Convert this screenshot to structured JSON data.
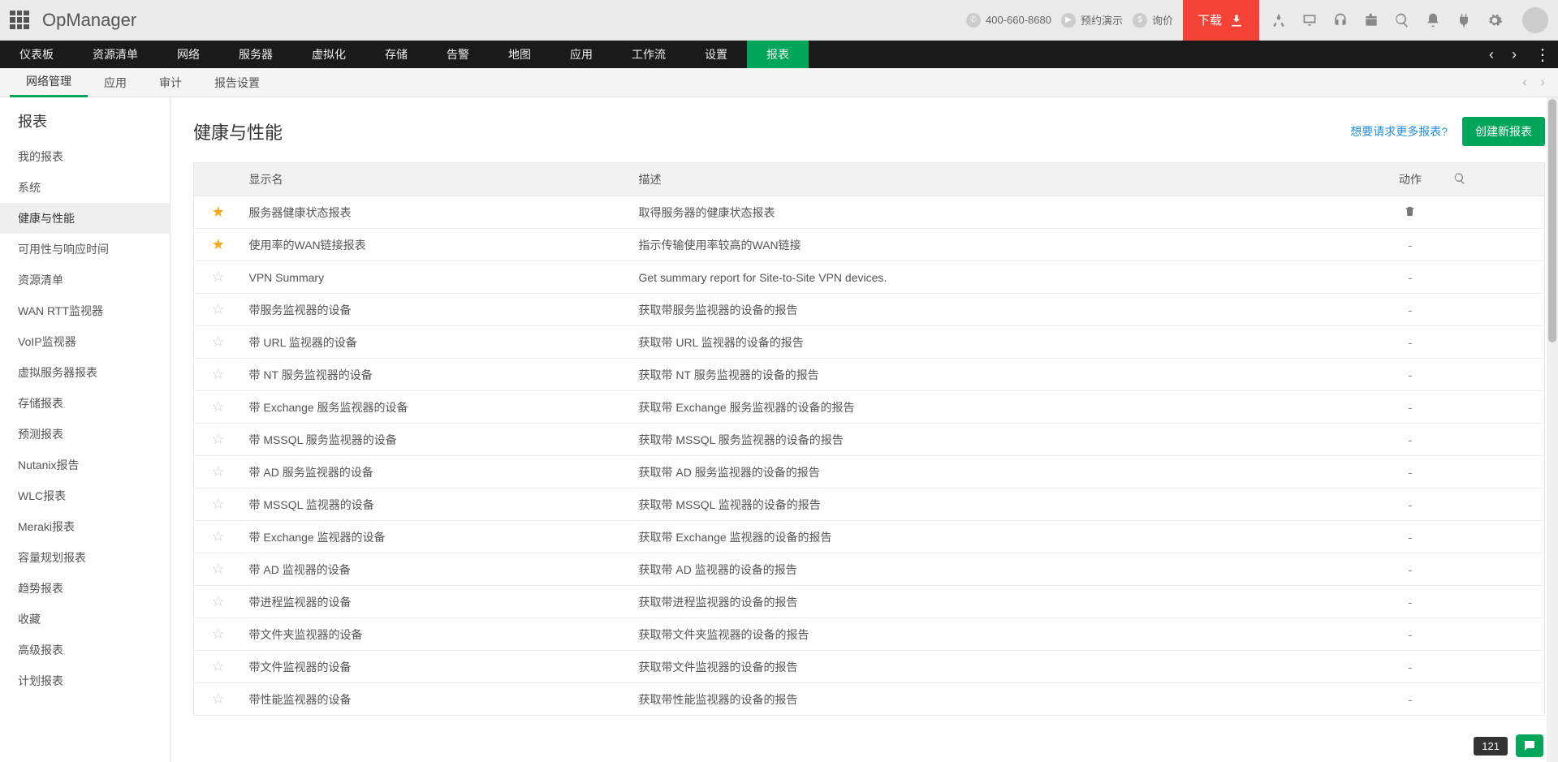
{
  "header": {
    "logo": "OpManager",
    "phone": "400-660-8680",
    "demo": "预约演示",
    "inquiry": "询价",
    "download": "下载"
  },
  "mainNav": [
    "仪表板",
    "资源清单",
    "网络",
    "服务器",
    "虚拟化",
    "存储",
    "告警",
    "地图",
    "应用",
    "工作流",
    "设置",
    "报表"
  ],
  "mainNavActive": "报表",
  "subNav": [
    "网络管理",
    "应用",
    "审计",
    "报告设置"
  ],
  "subNavActive": "网络管理",
  "sidebar": {
    "title": "报表",
    "items": [
      "我的报表",
      "系统",
      "健康与性能",
      "可用性与响应时间",
      "资源清单",
      "WAN RTT监视器",
      "VoIP监视器",
      "虚拟服务器报表",
      "存储报表",
      "预测报表",
      "Nutanix报告",
      "WLC报表",
      "Meraki报表",
      "容量规划报表",
      "趋势报表",
      "收藏",
      "高级报表",
      "计划报表"
    ],
    "active": "健康与性能"
  },
  "content": {
    "title": "健康与性能",
    "requestMore": "想要请求更多报表?",
    "createBtn": "创建新报表",
    "columns": {
      "name": "显示名",
      "desc": "描述",
      "action": "动作"
    },
    "rows": [
      {
        "fav": true,
        "name": "服务器健康状态报表",
        "desc": "取得服务器的健康状态报表",
        "deletable": true
      },
      {
        "fav": true,
        "name": "使用率的WAN链接报表",
        "desc": "指示传输使用率较高的WAN链接",
        "deletable": false
      },
      {
        "fav": false,
        "name": "VPN Summary",
        "desc": "Get summary report for Site-to-Site VPN devices.",
        "deletable": false
      },
      {
        "fav": false,
        "name": "带服务监视器的设备",
        "desc": "获取带服务监视器的设备的报告",
        "deletable": false
      },
      {
        "fav": false,
        "name": "带 URL 监视器的设备",
        "desc": "获取带 URL 监视器的设备的报告",
        "deletable": false
      },
      {
        "fav": false,
        "name": "带 NT 服务监视器的设备",
        "desc": "获取带 NT 服务监视器的设备的报告",
        "deletable": false
      },
      {
        "fav": false,
        "name": "带 Exchange 服务监视器的设备",
        "desc": "获取带 Exchange 服务监视器的设备的报告",
        "deletable": false
      },
      {
        "fav": false,
        "name": "带 MSSQL 服务监视器的设备",
        "desc": "获取带 MSSQL 服务监视器的设备的报告",
        "deletable": false
      },
      {
        "fav": false,
        "name": "带 AD 服务监视器的设备",
        "desc": "获取带 AD 服务监视器的设备的报告",
        "deletable": false
      },
      {
        "fav": false,
        "name": "带 MSSQL 监视器的设备",
        "desc": "获取带 MSSQL 监视器的设备的报告",
        "deletable": false
      },
      {
        "fav": false,
        "name": "带 Exchange 监视器的设备",
        "desc": "获取带 Exchange 监视器的设备的报告",
        "deletable": false
      },
      {
        "fav": false,
        "name": "带 AD 监视器的设备",
        "desc": "获取带 AD 监视器的设备的报告",
        "deletable": false
      },
      {
        "fav": false,
        "name": "带进程监视器的设备",
        "desc": "获取带进程监视器的设备的报告",
        "deletable": false
      },
      {
        "fav": false,
        "name": "带文件夹监视器的设备",
        "desc": "获取带文件夹监视器的设备的报告",
        "deletable": false
      },
      {
        "fav": false,
        "name": "带文件监视器的设备",
        "desc": "获取带文件监视器的设备的报告",
        "deletable": false
      },
      {
        "fav": false,
        "name": "带性能监视器的设备",
        "desc": "获取带性能监视器的设备的报告",
        "deletable": false
      }
    ]
  },
  "footer": {
    "count": "121"
  }
}
